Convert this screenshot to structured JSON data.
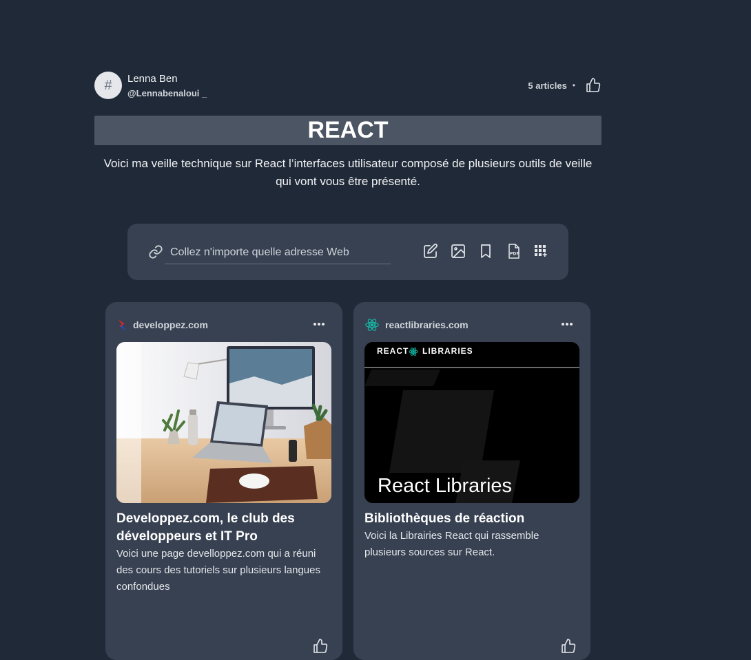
{
  "author": {
    "avatar_symbol": "#",
    "name": "Lenna Ben",
    "handle": "@Lennabenaloui _"
  },
  "stats": {
    "articles": "5 articles",
    "separator": "•"
  },
  "topic": {
    "title": "REACT",
    "description": "Voici ma veille technique sur React l’interfaces utilisateur composé de plusieurs outils de veille qui vont vous être présenté."
  },
  "url_bar": {
    "placeholder": "Collez n'importe quelle adresse Web",
    "value": "",
    "tools": [
      "edit-icon",
      "image-icon",
      "bookmark-icon",
      "pdf-icon",
      "grid-add-icon"
    ]
  },
  "cards": [
    {
      "source": "developpez.com",
      "source_icon": "developpez-logo-icon",
      "image": "desk-workspace-photo",
      "title": "Developpez.com, le club des développeurs et IT Pro",
      "description": "Voici une page develloppez.com qui a réuni des cours des tutoriels sur plusieurs langues confondues"
    },
    {
      "source": "reactlibraries.com",
      "source_icon": "react-atom-icon",
      "image_banner_left": "REACT",
      "image_banner_right": "LIBRARIES",
      "image_caption": "React Libraries",
      "title": "Bibliothèques de réaction",
      "description": "Voici la Librairies React qui rassemble plusieurs sources sur React."
    }
  ],
  "colors": {
    "background": "#1f2937",
    "panel": "#374151",
    "title_bar": "#4b5563",
    "react_accent": "#14b8a6"
  }
}
